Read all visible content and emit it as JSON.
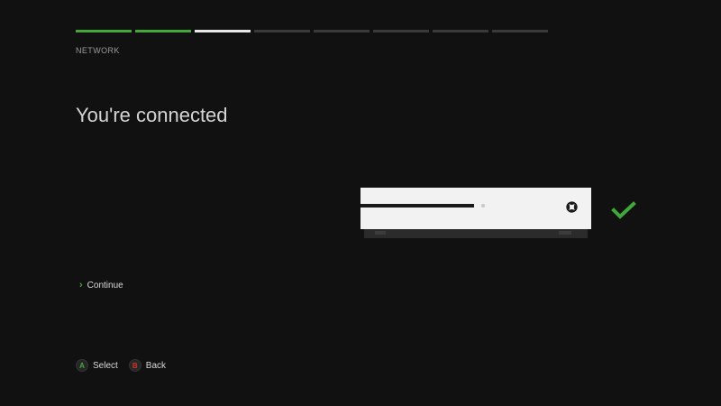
{
  "progress": {
    "total_steps": 8,
    "completed_steps": 2,
    "current_step": 3,
    "colors": {
      "completed": "#45a63a",
      "current": "#e8e8e8",
      "pending": "#3a3a3a"
    }
  },
  "header": {
    "section_label": "NETWORK"
  },
  "main": {
    "title": "You're connected",
    "status_icon": "checkmark-icon",
    "status_color": "#3ea83a",
    "illustration": "xbox-one-s-console"
  },
  "menu": {
    "continue_label": "Continue",
    "continue_icon": "chevron-right-icon"
  },
  "footer": {
    "hints": [
      {
        "button": "A",
        "label": "Select",
        "color": "#45a63a"
      },
      {
        "button": "B",
        "label": "Back",
        "color": "#d2332c"
      }
    ]
  }
}
